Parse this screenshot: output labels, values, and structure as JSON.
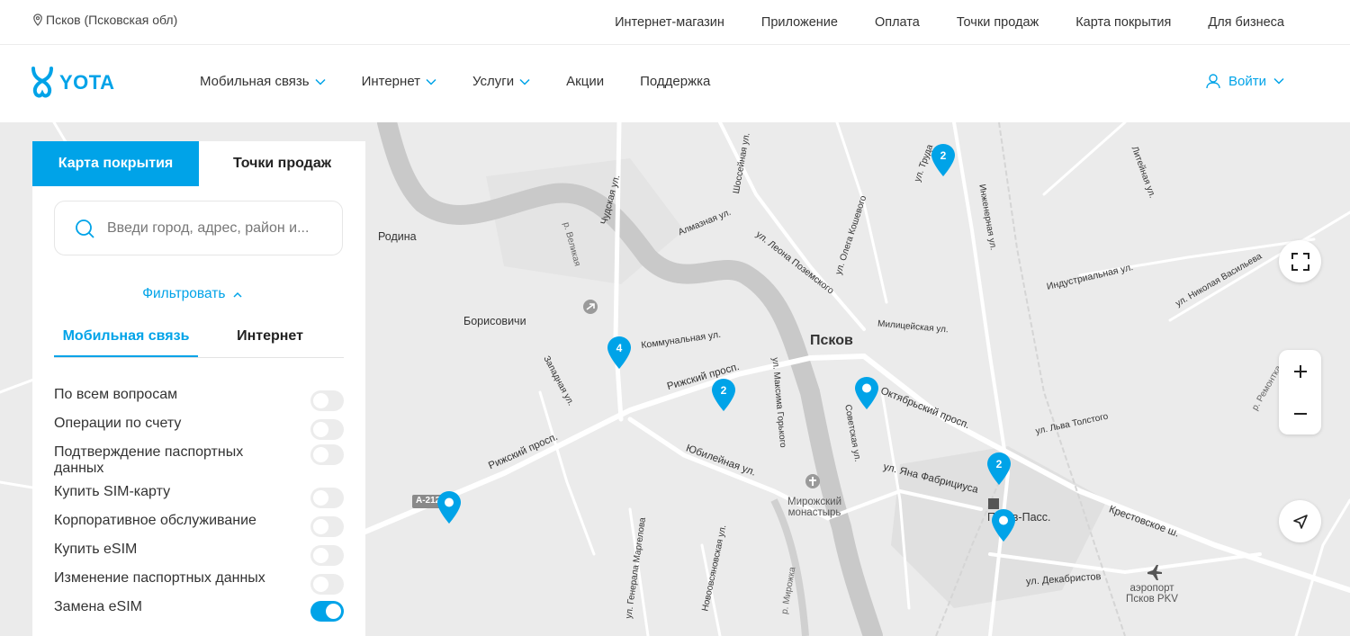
{
  "location": "Псков (Псковская обл)",
  "top_links": [
    "Интернет-магазин",
    "Приложение",
    "Оплата",
    "Точки продаж",
    "Карта покрытия",
    "Для бизнеса"
  ],
  "logo": "YOTA",
  "main_nav": [
    {
      "label": "Мобильная связь"
    },
    {
      "label": "Интернет"
    },
    {
      "label": "Услуги"
    },
    {
      "label": "Акции"
    },
    {
      "label": "Поддержка"
    }
  ],
  "login": "Войти",
  "panel": {
    "tabs": [
      "Карта покрытия",
      "Точки продаж"
    ],
    "search_placeholder": "Введи город, адрес, район и...",
    "filter": "Фильтровать",
    "subtabs": [
      "Мобильная связь",
      "Интернет"
    ],
    "options": [
      {
        "label": "По всем вопросам",
        "on": false
      },
      {
        "label": "Операции по счету",
        "on": false
      },
      {
        "label": "Подтверждение паспортных данных",
        "on": false
      },
      {
        "label": "Купить SIM-карту",
        "on": false
      },
      {
        "label": "Корпоративное обслуживание",
        "on": false
      },
      {
        "label": "Купить eSIM",
        "on": false
      },
      {
        "label": "Изменение паспортных данных",
        "on": false
      },
      {
        "label": "Замена eSIM",
        "on": true
      }
    ]
  },
  "map": {
    "city": "Псков",
    "places": [
      "Родина",
      "Борисовичи",
      "Мирожский монастырь",
      "аэропорт Псков PKV",
      "Псков-Пасс."
    ],
    "streets": [
      "Рижский просп.",
      "Коммунальная ул.",
      "Юбилейная ул.",
      "Октябрьский просп.",
      "ул. Яна Фабрициуса",
      "Крестовское ш.",
      "ул. Декабристов",
      "Индустриальная ул.",
      "Инженерная ул.",
      "ул. Леона Поземского",
      "Чудская ул.",
      "Западная ул.",
      "Советская ул.",
      "ул. Максима Горького",
      "Новоовсяновская ул.",
      "ул. Генерала Маргелова",
      "ул. Николая Васильева",
      "ул. Льва Толстого",
      "Алмазная ул.",
      "Шоссейная ул.",
      "Милицейская ул.",
      "ул. Труда",
      "ул. Олега Кошевого",
      "р. Великая",
      "р. Мирожка",
      "р. Ремонтка",
      "Литейная ул.",
      "A-212"
    ],
    "pins": [
      {
        "count": "2"
      },
      {
        "count": "4"
      },
      {
        "count": "2"
      },
      {
        "count": ""
      },
      {
        "count": "2"
      },
      {
        "count": ""
      },
      {
        "count": ""
      }
    ],
    "colors": {
      "accent": "#00a3e8",
      "river": "#c9c9c9",
      "land": "#ebebeb",
      "road": "#ffffff"
    }
  }
}
